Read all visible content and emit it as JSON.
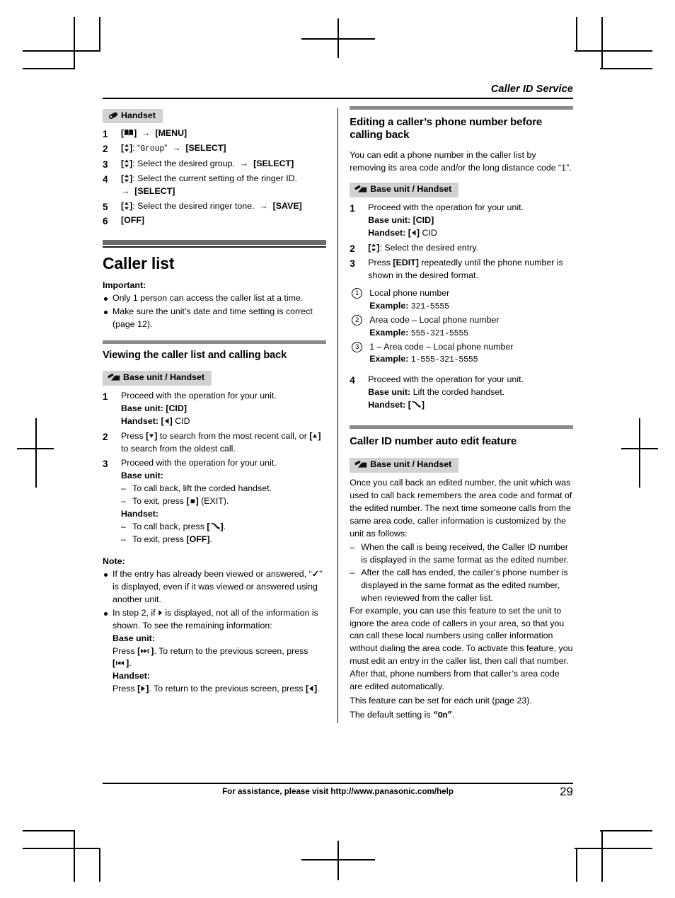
{
  "running_head": "Caller ID Service",
  "footer": {
    "assistance": "For assistance, please visit http://www.panasonic.com/help",
    "page_number": "29"
  },
  "left_column": {
    "handset_badge": "Handset",
    "ringer_steps": [
      {
        "num": "1",
        "text": "[\u0001] → [MENU]"
      },
      {
        "num": "2",
        "text": "[↕]: “Group” → [SELECT]"
      },
      {
        "num": "3",
        "text": "[↕]: Select the desired group. → [SELECT]"
      },
      {
        "num": "4",
        "text": "[↕]: Select the current setting of the ringer ID. → [SELECT]"
      },
      {
        "num": "5",
        "text": "[↕]: Select the desired ringer tone. → [SAVE]"
      },
      {
        "num": "6",
        "text": "[OFF]"
      }
    ],
    "section_title": "Caller list",
    "important_label": "Important:",
    "important_items": [
      "Only 1 person can access the caller list at a time.",
      "Make sure the unit’s date and time setting is correct (page 12)."
    ],
    "subsection_title": "Viewing the caller list and calling back",
    "base_handset_badge": "Base unit / Handset",
    "view_steps": [
      {
        "num": "1",
        "line1": "Proceed with the operation for your unit.",
        "base_label": "Base unit:",
        "base_key": "[CID]",
        "handset_label": "Handset:",
        "handset_key": "[◄]",
        "handset_suffix": "CID"
      },
      {
        "num": "2",
        "line1": "Press [▼] to search from the most recent call, or [▲] to search from the oldest call."
      },
      {
        "num": "3",
        "line1": "Proceed with the operation for your unit.",
        "base_label": "Base unit:",
        "base_items": [
          "To call back, lift the corded handset.",
          "To exit, press [■] (EXIT)."
        ],
        "handset_label": "Handset:",
        "handset_items": [
          "To call back, press [✆].",
          "To exit, press [OFF]."
        ]
      }
    ],
    "note_label": "Note:",
    "note_items": [
      "If the entry has already been viewed or answered, “✓” is displayed, even if it was viewed or answered using another unit.",
      "In step 2, if ▶ is displayed, not all of the information is shown. To see the remaining information:"
    ],
    "note_base_label": "Base unit:",
    "note_base_text": "Press [▶▶|]. To return to the previous screen, press [|◄◄].",
    "note_handset_label": "Handset:",
    "note_handset_text": "Press [▶]. To return to the previous screen, press [◄]."
  },
  "right_column": {
    "edit_title": "Editing a caller’s phone number before calling back",
    "edit_intro": "You can edit a phone number in the caller list by removing its area code and/or the long distance code “1”.",
    "base_handset_badge": "Base unit / Handset",
    "edit_steps": [
      {
        "num": "1",
        "line1": "Proceed with the operation for your unit.",
        "base_label": "Base unit:",
        "base_key": "[CID]",
        "handset_label": "Handset:",
        "handset_key": "[◄]",
        "handset_suffix": "CID"
      },
      {
        "num": "2",
        "line1": "[↕]: Select the desired entry."
      },
      {
        "num": "3",
        "line1": "Press [EDIT] repeatedly until the phone number is shown in the desired format."
      }
    ],
    "formats": [
      {
        "n": "1",
        "label": "Local phone number",
        "example_label": "Example:",
        "example": "321-5555"
      },
      {
        "n": "2",
        "label": "Area code – Local phone number",
        "example_label": "Example:",
        "example": "555-321-5555"
      },
      {
        "n": "3",
        "label": "1 – Area code – Local phone number",
        "example_label": "Example:",
        "example": "1-555-321-5555"
      }
    ],
    "step4": {
      "num": "4",
      "line1": "Proceed with the operation for your unit.",
      "base_label": "Base unit:",
      "base_text": "Lift the corded handset.",
      "handset_label": "Handset:",
      "handset_key": "[✆]"
    },
    "auto_edit_title": "Caller ID number auto edit feature",
    "auto_badge": "Base unit / Handset",
    "auto_intro": "Once you call back an edited number, the unit which was used to call back remembers the area code and format of the edited number. The next time someone calls from the same area code, caller information is customized by the unit as follows:",
    "auto_items": [
      "When the call is being received, the Caller ID number is displayed in the same format as the edited number.",
      "After the call has ended, the caller’s phone number is displayed in the same format as the edited number, when reviewed from the caller list."
    ],
    "auto_example": "For example, you can use this feature to set the unit to ignore the area code of callers in your area, so that you can call these local numbers using caller information without dialing the area code. To activate this feature, you must edit an entry in the caller list, then call that number. After that, phone numbers from that caller’s area code are edited automatically.",
    "auto_footer_1": "This feature can be set for each unit (page 23).",
    "auto_footer_2_prefix": "The default setting is ",
    "auto_footer_2_value": "“On”",
    "auto_footer_2_suffix": "."
  }
}
